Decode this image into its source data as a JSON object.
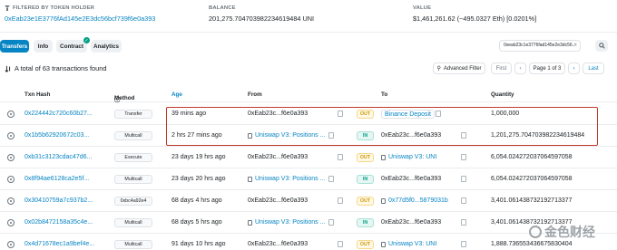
{
  "header": {
    "filtered": {
      "caption": "FILTERED BY TOKEN HOLDER",
      "address": "0xEab23e1E3776fAd145e2E3dc56bcf739f6e0a393"
    },
    "balance": {
      "caption": "BALANCE",
      "value": "201,275.704703982234619484 UNI"
    },
    "value": {
      "caption": "VALUE",
      "value": "$1,461,261.62 (~495.0327 Eth) [0.0201%]"
    }
  },
  "tabs": [
    {
      "label": "Transfers",
      "active": true
    },
    {
      "label": "Info",
      "active": false
    },
    {
      "label": "Contract",
      "active": false,
      "verified": true
    },
    {
      "label": "Analytics",
      "active": false
    }
  ],
  "address_filter": {
    "value": "0xeab23c1e3776fad145e2e3dc56...",
    "clear": "×"
  },
  "summary": {
    "text": "A total of 63 transactions found",
    "advanced_filter": "Advanced Filter",
    "first": "First",
    "page": "Page 1 of 3",
    "last": "Last"
  },
  "columns": {
    "hash": "Txn Hash",
    "method": "Method",
    "age": "Age",
    "from": "From",
    "to": "To",
    "quantity": "Quantity"
  },
  "rows": [
    {
      "hash": "0x224442c720c60b27...",
      "method": "Transfer",
      "age": "39 mins ago",
      "from": "0xEab23c...f6e0a393",
      "dir": "OUT",
      "to": "Binance Deposit",
      "qty": "1,000,000"
    },
    {
      "hash": "0x1b5b62920672c03...",
      "method": "Multicall",
      "age": "2 hrs 27 mins ago",
      "from": "Uniswap V3: Positions ...",
      "dir": "IN",
      "to": "0xEab23c...f6e0a393",
      "qty": "1,201,275.704703982234619484"
    },
    {
      "hash": "0xb31c3123cdac47d6...",
      "method": "Execute",
      "age": "23 days 19 hrs ago",
      "from": "0xEab23c...f6e0a393",
      "dir": "OUT",
      "to": "Uniswap V3: UNI",
      "qty": "6,054.024272037064597058"
    },
    {
      "hash": "0x8f94ae6128ca2e5f...",
      "method": "Multicall",
      "age": "23 days 20 hrs ago",
      "from": "Uniswap V3: Positions ...",
      "dir": "IN",
      "to": "0xEab23c...f6e0a393",
      "qty": "6,054.024272037064597058"
    },
    {
      "hash": "0x30410759a7c937b2...",
      "method": "0xbc4a92e4",
      "age": "68 days 4 hrs ago",
      "from": "0xEab23c...f6e0a393",
      "dir": "OUT",
      "to": "0x77d5f0...5879031b",
      "qty": "3,401.061438732192713377"
    },
    {
      "hash": "0x02b8472158a35c4e...",
      "method": "Multicall",
      "age": "68 days 5 hrs ago",
      "from": "Uniswap V3: Positions ...",
      "dir": "IN",
      "to": "0xEab23c...f6e0a393",
      "qty": "3,401.061438732192713377"
    },
    {
      "hash": "0x4d71678ec1a9bef4e...",
      "method": "Multicall",
      "age": "91 days 10 hrs ago",
      "from": "0xEab23c...f6e0a393",
      "dir": "OUT",
      "to": "Uniswap V3: UNI",
      "qty": "1,888.736553436675830404"
    }
  ],
  "watermark": "金色财经",
  "colors": {
    "accent": "#0784c3",
    "highlight": "#c0392b",
    "in": "#00a186",
    "out": "#cc9a06"
  }
}
